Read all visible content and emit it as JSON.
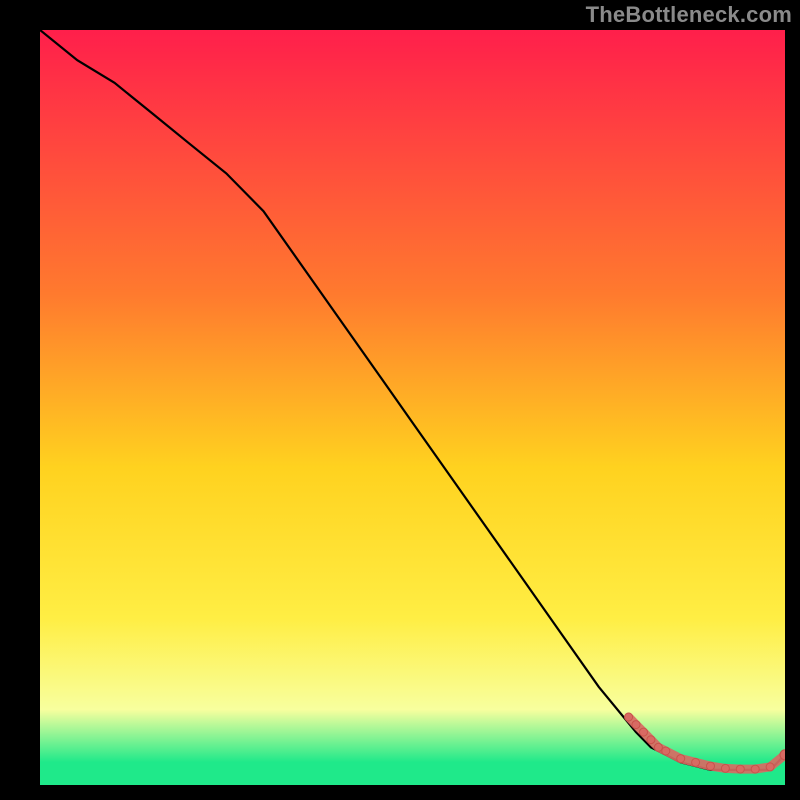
{
  "watermark": "TheBottleneck.com",
  "colors": {
    "bg": "#000000",
    "gradient_top": "#ff1f4b",
    "gradient_mid1": "#ff7a2e",
    "gradient_mid2": "#ffd21f",
    "gradient_mid3": "#ffee44",
    "gradient_low": "#f8ff9e",
    "gradient_green": "#1fe98a",
    "curve": "#000000",
    "marker_fill": "#d86a63",
    "marker_stroke": "#c9524b"
  },
  "chart_data": {
    "type": "line",
    "title": "",
    "xlabel": "",
    "ylabel": "",
    "xlim": [
      0,
      100
    ],
    "ylim": [
      0,
      100
    ],
    "grid": false,
    "legend": false,
    "series": [
      {
        "name": "bottleneck-curve",
        "x": [
          0,
          5,
          10,
          15,
          20,
          25,
          30,
          35,
          40,
          45,
          50,
          55,
          60,
          65,
          70,
          75,
          80,
          82,
          84,
          86,
          88,
          90,
          92,
          94,
          96,
          97,
          98,
          100
        ],
        "y": [
          100,
          96,
          93,
          89,
          85,
          81,
          76,
          69,
          62,
          55,
          48,
          41,
          34,
          27,
          20,
          13,
          7,
          5,
          4,
          3,
          2.5,
          2,
          2,
          2,
          2,
          2,
          2,
          4
        ]
      },
      {
        "name": "selected-range-markers",
        "x": [
          79,
          80,
          81,
          82,
          83,
          84,
          86,
          88,
          90,
          92,
          94,
          96,
          98,
          100
        ],
        "y": [
          9,
          8,
          7,
          6,
          5,
          4.5,
          3.5,
          3,
          2.5,
          2.2,
          2.1,
          2.1,
          2.4,
          4
        ]
      }
    ]
  }
}
